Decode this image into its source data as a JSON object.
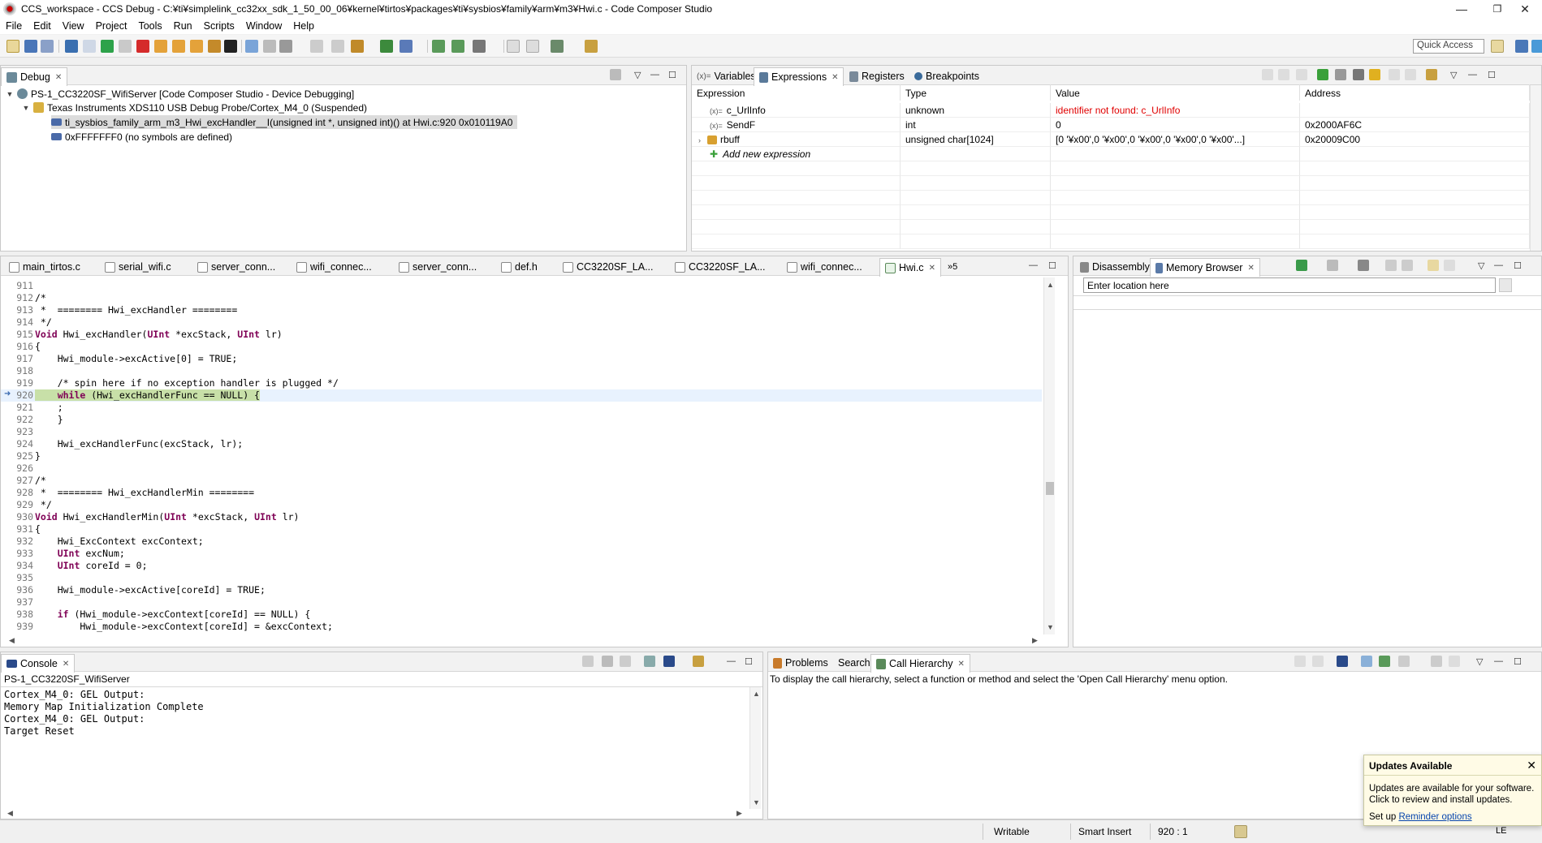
{
  "window": {
    "title": "CCS_workspace - CCS Debug - C:¥ti¥simplelink_cc32xx_sdk_1_50_00_06¥kernel¥tirtos¥packages¥ti¥sysbios¥family¥arm¥m3¥Hwi.c - Code Composer Studio",
    "minimize": "—",
    "maximize": "❐",
    "close": "✕"
  },
  "menu": [
    "File",
    "Edit",
    "View",
    "Project",
    "Tools",
    "Run",
    "Scripts",
    "Window",
    "Help"
  ],
  "toolbar": {
    "quick_access_placeholder": "Quick Access"
  },
  "debug_view": {
    "tab": "Debug",
    "rows": [
      {
        "text": "PS-1_CC3220SF_WifiServer [Code Composer Studio - Device Debugging]"
      },
      {
        "text": "Texas Instruments XDS110 USB Debug Probe/Cortex_M4_0 (Suspended)"
      },
      {
        "text": "ti_sysbios_family_arm_m3_Hwi_excHandler__I(unsigned int *, unsigned int)() at Hwi.c:920 0x010119A0"
      },
      {
        "text": "0xFFFFFFF0  (no symbols are defined)"
      }
    ]
  },
  "expressions_view": {
    "tabs": [
      "Variables",
      "Expressions",
      "Registers",
      "Breakpoints"
    ],
    "columns": [
      "Expression",
      "Type",
      "Value",
      "Address"
    ],
    "rows": [
      {
        "expression": "c_UrlInfo",
        "type": "unknown",
        "value": "identifier not found: c_UrlInfo",
        "address": ""
      },
      {
        "expression": "SendF",
        "type": "int",
        "value": "0",
        "address": "0x2000AF6C"
      },
      {
        "expression": "rbuff",
        "type": "unsigned char[1024]",
        "value": "[0 '¥x00',0 '¥x00',0 '¥x00',0 '¥x00',0 '¥x00'...]",
        "address": "0x20009C00"
      }
    ],
    "add_new": "Add new expression"
  },
  "editor": {
    "tabs": [
      "main_tirtos.c",
      "serial_wifi.c",
      "server_conn...",
      "wifi_connec...",
      "server_conn...",
      "def.h",
      "CC3220SF_LA...",
      "CC3220SF_LA...",
      "wifi_connec...",
      "Hwi.c"
    ],
    "overflow": "»5",
    "lines": [
      {
        "n": "911",
        "code": ""
      },
      {
        "n": "912",
        "code": "/*"
      },
      {
        "n": "913",
        "code": " *  ======== Hwi_excHandler ========"
      },
      {
        "n": "914",
        "code": " */"
      },
      {
        "n": "915",
        "code": "Void Hwi_excHandler(UInt *excStack, UInt lr)"
      },
      {
        "n": "916",
        "code": "{"
      },
      {
        "n": "917",
        "code": "    Hwi_module->excActive[0] = TRUE;"
      },
      {
        "n": "918",
        "code": ""
      },
      {
        "n": "919",
        "code": "    /* spin here if no exception handler is plugged */"
      },
      {
        "n": "920",
        "code": "    while (Hwi_excHandlerFunc == NULL) {"
      },
      {
        "n": "921",
        "code": "    ;"
      },
      {
        "n": "922",
        "code": "    }"
      },
      {
        "n": "923",
        "code": ""
      },
      {
        "n": "924",
        "code": "    Hwi_excHandlerFunc(excStack, lr);"
      },
      {
        "n": "925",
        "code": "}"
      },
      {
        "n": "926",
        "code": ""
      },
      {
        "n": "927",
        "code": "/*"
      },
      {
        "n": "928",
        "code": " *  ======== Hwi_excHandlerMin ========"
      },
      {
        "n": "929",
        "code": " */"
      },
      {
        "n": "930",
        "code": "Void Hwi_excHandlerMin(UInt *excStack, UInt lr)"
      },
      {
        "n": "931",
        "code": "{"
      },
      {
        "n": "932",
        "code": "    Hwi_ExcContext excContext;"
      },
      {
        "n": "933",
        "code": "    UInt excNum;"
      },
      {
        "n": "934",
        "code": "    UInt coreId = 0;"
      },
      {
        "n": "935",
        "code": ""
      },
      {
        "n": "936",
        "code": "    Hwi_module->excActive[coreId] = TRUE;"
      },
      {
        "n": "937",
        "code": ""
      },
      {
        "n": "938",
        "code": "    if (Hwi_module->excContext[coreId] == NULL) {"
      },
      {
        "n": "939",
        "code": "        Hwi_module->excContext[coreId] = &excContext;"
      }
    ]
  },
  "memory_view": {
    "tabs": [
      "Disassembly",
      "Memory Browser"
    ],
    "location_placeholder": "Enter location here"
  },
  "console": {
    "tab": "Console",
    "session": "PS-1_CC3220SF_WifiServer",
    "lines": [
      "Cortex_M4_0: GEL Output:",
      "Memory Map Initialization Complete",
      "Cortex_M4_0: GEL Output:",
      "Target Reset"
    ]
  },
  "call_hierarchy": {
    "tabs": [
      "Problems",
      "Search",
      "Call Hierarchy"
    ],
    "message": "To display the call hierarchy, select a function or method and select the 'Open Call Hierarchy' menu option."
  },
  "status": {
    "writable": "Writable",
    "insert": "Smart Insert",
    "position": "920 : 1",
    "encoding": "LE"
  },
  "notification": {
    "title": "Updates Available",
    "body": "Updates are available for your software. Click to review and install updates.",
    "setup_prefix": "Set up",
    "link": "Reminder options"
  },
  "colors": {
    "error": "#e00000",
    "highlight": "#e8f2fe",
    "current_line": "#c8e0a8"
  }
}
